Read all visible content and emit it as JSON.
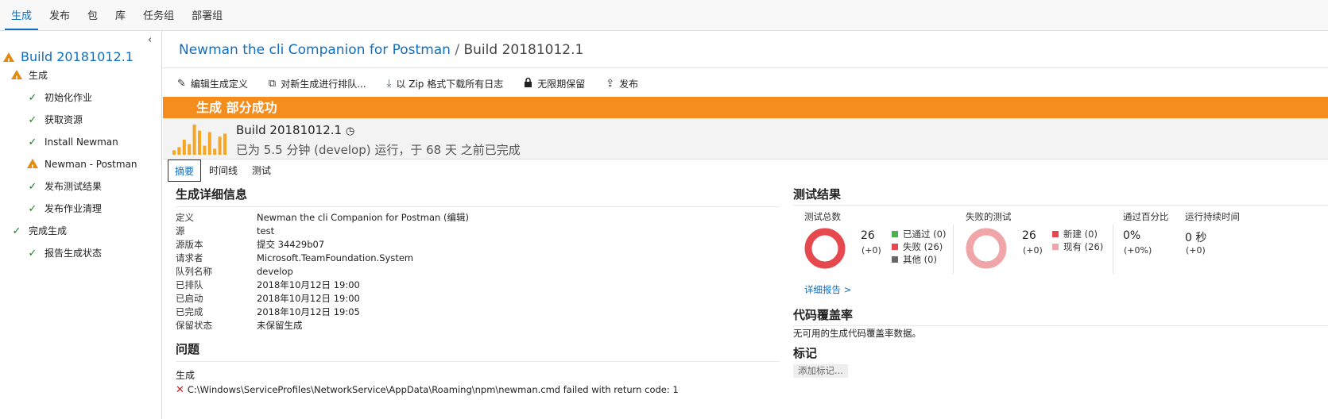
{
  "topnav": {
    "items": [
      "生成",
      "发布",
      "包",
      "库",
      "任务组",
      "部署组"
    ],
    "active": "生成"
  },
  "sidebar": {
    "root": "Build 20181012.1",
    "items": [
      {
        "label": "生成",
        "status": "warning"
      },
      {
        "label": "初始化作业",
        "status": "success"
      },
      {
        "label": "获取资源",
        "status": "success"
      },
      {
        "label": "Install Newman",
        "status": "success"
      },
      {
        "label": "Newman - Postman",
        "status": "warning"
      },
      {
        "label": "发布测试结果",
        "status": "success"
      },
      {
        "label": "发布作业清理",
        "status": "success"
      },
      {
        "label": "完成生成",
        "status": "success"
      },
      {
        "label": "报告生成状态",
        "status": "success"
      }
    ]
  },
  "breadcrumb": {
    "pipeline": "Newman the cli Companion for Postman",
    "separator": "/",
    "build": "Build 20181012.1"
  },
  "toolbar": {
    "edit": "编辑生成定义",
    "queue": "对新生成进行排队...",
    "download": "以 Zip 格式下载所有日志",
    "retain": "无限期保留",
    "release": "发布"
  },
  "banner": {
    "text": "生成 部分成功",
    "color": "#f58c1e"
  },
  "summary": {
    "build_name": "Build 20181012.1",
    "subtitle": "已为 5.5 分钟 (develop) 运行，于 68 天 之前已完成",
    "history": [
      0.15,
      0.25,
      0.5,
      0.35,
      1.0,
      0.8,
      0.3,
      0.75,
      0.2,
      0.6,
      0.7
    ],
    "history_color": "#f5a623"
  },
  "tabs": [
    "摘要",
    "时间线",
    "测试"
  ],
  "details": {
    "title": "生成详细信息",
    "rows": [
      {
        "key": "定义",
        "value": "Newman the cli Companion for Postman (编辑)",
        "link": true
      },
      {
        "key": "源",
        "value": "test",
        "link": true
      },
      {
        "key": "源版本",
        "value": "提交 34429b07",
        "link": true
      },
      {
        "key": "请求者",
        "value": "Microsoft.TeamFoundation.System",
        "link": false
      },
      {
        "key": "队列名称",
        "value": "develop",
        "link": true
      },
      {
        "key": "已排队",
        "value": "2018年10月12日 19:00",
        "link": false
      },
      {
        "key": "已启动",
        "value": "2018年10月12日 19:00",
        "link": false
      },
      {
        "key": "已完成",
        "value": "2018年10月12日 19:05",
        "link": false
      },
      {
        "key": "保留状态",
        "value": "未保留生成",
        "link": false
      }
    ]
  },
  "issues": {
    "title": "问题",
    "category": "生成",
    "items": [
      "C:\\Windows\\ServiceProfiles\\NetworkService\\AppData\\Roaming\\npm\\newman.cmd failed with return code: 1"
    ]
  },
  "tests": {
    "title": "测试结果",
    "total": {
      "label": "测试总数",
      "value": "26",
      "delta": "(+0)",
      "legend": [
        {
          "label": "已通过 (0)",
          "color": "#4caf50"
        },
        {
          "label": "失败 (26)",
          "color": "#e5484d"
        },
        {
          "label": "其他 (0)",
          "color": "#666666"
        }
      ],
      "ring_color": "#e5484d"
    },
    "failed": {
      "label": "失败的测试",
      "value": "26",
      "delta": "(+0)",
      "legend": [
        {
          "label": "新建 (0)",
          "color": "#e5484d"
        },
        {
          "label": "现有 (26)",
          "color": "#f0a5a8"
        }
      ],
      "ring_color": "#f0a5a8"
    },
    "pass_rate": {
      "label": "通过百分比",
      "value": "0%",
      "delta": "(+0%)"
    },
    "duration": {
      "label": "运行持续时间",
      "value": "0 秒",
      "delta": "(+0)"
    },
    "detail_link": "详细报告 >"
  },
  "coverage": {
    "title": "代码覆盖率",
    "text": "无可用的生成代码覆盖率数据。"
  },
  "tags": {
    "title": "标记",
    "add_label": "添加标记..."
  }
}
